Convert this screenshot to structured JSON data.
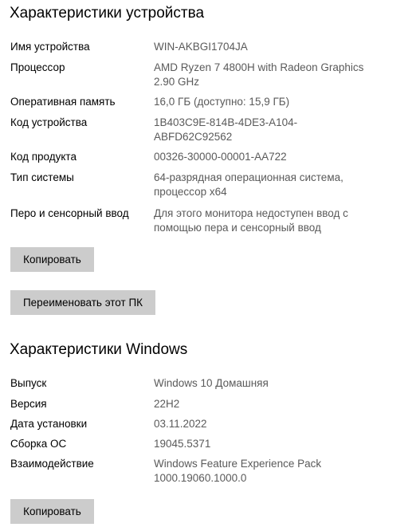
{
  "device": {
    "title": "Характеристики устройства",
    "specs": [
      {
        "label": "Имя устройства",
        "value": "WIN-AKBGI1704JA"
      },
      {
        "label": "Процессор",
        "value": "AMD Ryzen 7 4800H with Radeon Graphics\n2.90 GHz"
      },
      {
        "label": "Оперативная память",
        "value": "16,0 ГБ (доступно: 15,9 ГБ)"
      },
      {
        "label": "Код устройства",
        "value": "1B403C9E-814B-4DE3-A104-\nABFD62C92562"
      },
      {
        "label": "Код продукта",
        "value": "00326-30000-00001-AA722"
      },
      {
        "label": "Тип системы",
        "value": "64-разрядная операционная система,\nпроцессор x64"
      },
      {
        "label": "Перо и сенсорный ввод",
        "value": "Для этого монитора недоступен ввод с\nпомощью пера и сенсорный ввод"
      }
    ],
    "copy_label": "Копировать",
    "rename_label": "Переименовать этот ПК"
  },
  "windows": {
    "title": "Характеристики Windows",
    "specs": [
      {
        "label": "Выпуск",
        "value": "Windows 10 Домашняя"
      },
      {
        "label": "Версия",
        "value": "22H2"
      },
      {
        "label": "Дата установки",
        "value": "03.11.2022"
      },
      {
        "label": "Сборка ОС",
        "value": "19045.5371"
      },
      {
        "label": "Взаимодействие",
        "value": "Windows Feature Experience Pack\n1000.19060.1000.0"
      }
    ],
    "copy_label": "Копировать"
  }
}
